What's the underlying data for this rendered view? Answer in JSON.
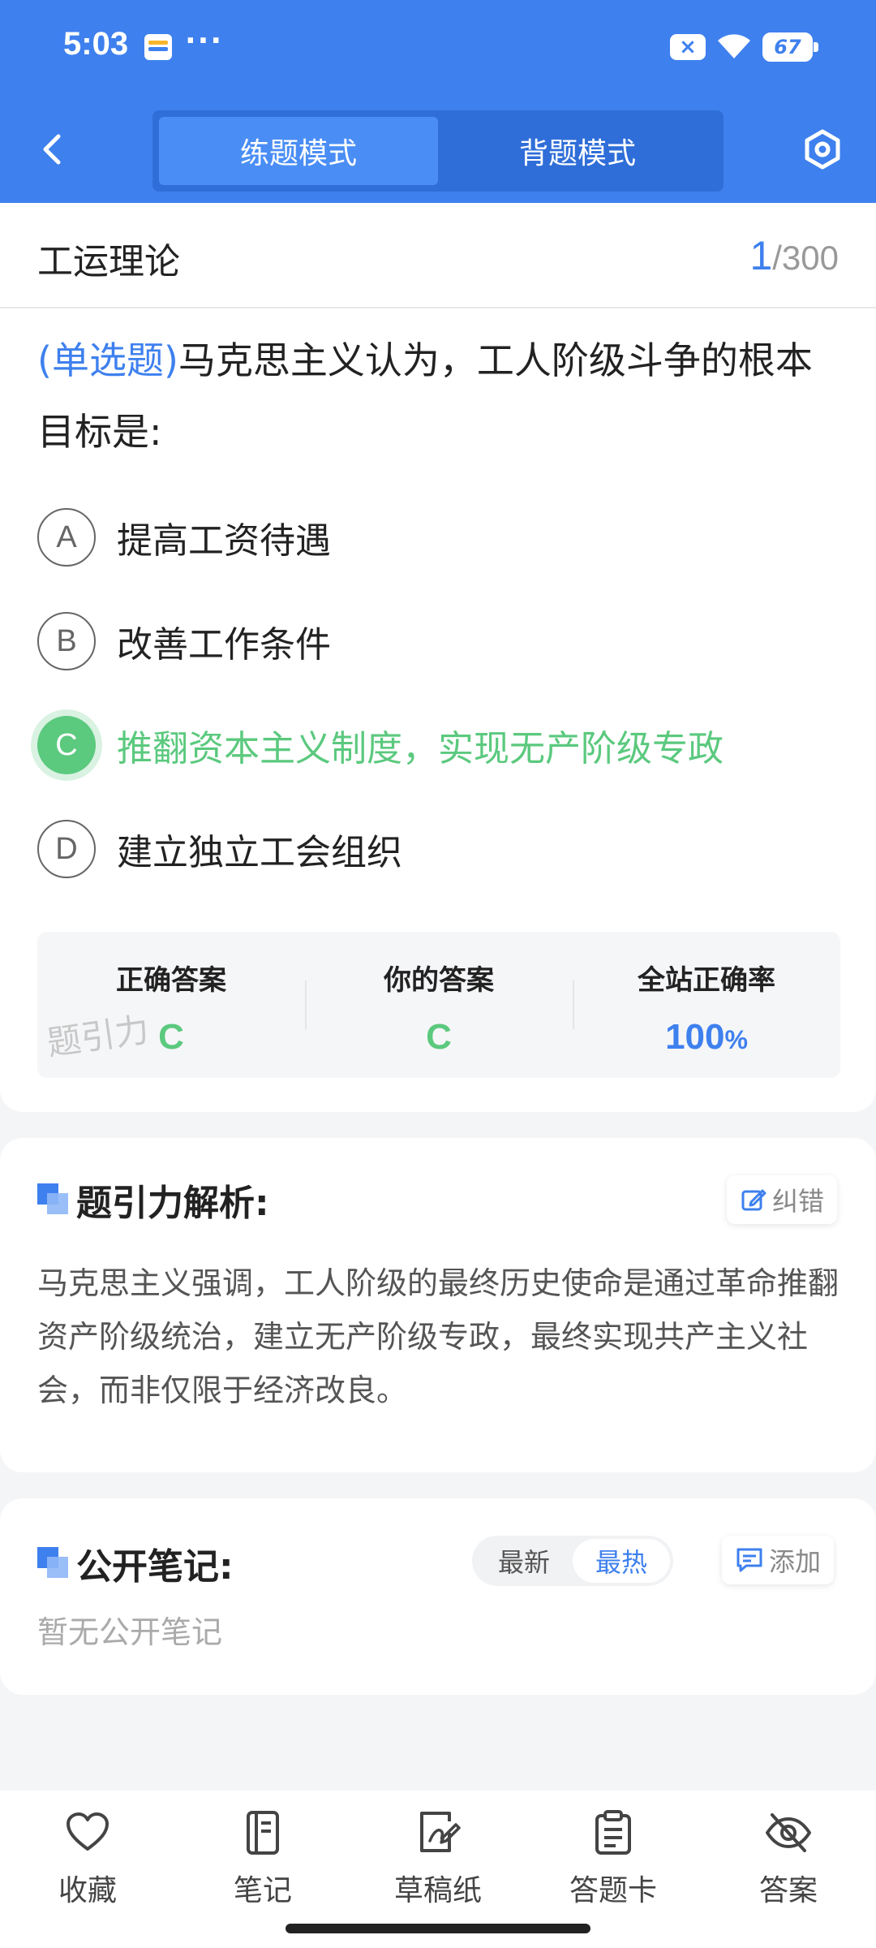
{
  "status_bar": {
    "time": "5:03",
    "dots": "···",
    "battery": "67",
    "sim_icon": "×"
  },
  "header": {
    "modes": [
      "练题模式",
      "背题模式"
    ],
    "active_mode": "练题模式"
  },
  "question": {
    "subject": "工运理论",
    "current": "1",
    "total": "/300",
    "type": "(单选题)",
    "text": "马克思主义认为，工人阶级斗争的根本目标是:",
    "options": [
      {
        "letter": "A",
        "text": "提高工资待遇"
      },
      {
        "letter": "B",
        "text": "改善工作条件"
      },
      {
        "letter": "C",
        "text": "推翻资本主义制度，实现无产阶级专政"
      },
      {
        "letter": "D",
        "text": "建立独立工会组织"
      }
    ],
    "selected": "C"
  },
  "answer_summary": {
    "correct_label": "正确答案",
    "correct_value": "C",
    "yours_label": "你的答案",
    "yours_value": "C",
    "rate_label": "全站正确率",
    "rate_value": "100",
    "rate_unit": "%",
    "watermark": "题引力"
  },
  "analysis": {
    "title": "题引力解析:",
    "report_label": "纠错",
    "text": "马克思主义强调，工人阶级的最终历史使命是通过革命推翻资产阶级统治，建立无产阶级专政，最终实现共产主义社会，而非仅限于经济改良。"
  },
  "notes": {
    "title": "公开笔记:",
    "sort_options": [
      "最新",
      "最热"
    ],
    "active_sort": "最热",
    "add_label": "添加",
    "empty_text": "暂无公开笔记"
  },
  "bottom_nav": [
    {
      "label": "收藏",
      "icon": "heart-icon"
    },
    {
      "label": "笔记",
      "icon": "notebook-icon"
    },
    {
      "label": "草稿纸",
      "icon": "draft-icon"
    },
    {
      "label": "答题卡",
      "icon": "answer-card-icon"
    },
    {
      "label": "答案",
      "icon": "eye-off-icon"
    }
  ],
  "colors": {
    "brand": "#3e80ee",
    "correct": "#5bc97e"
  }
}
